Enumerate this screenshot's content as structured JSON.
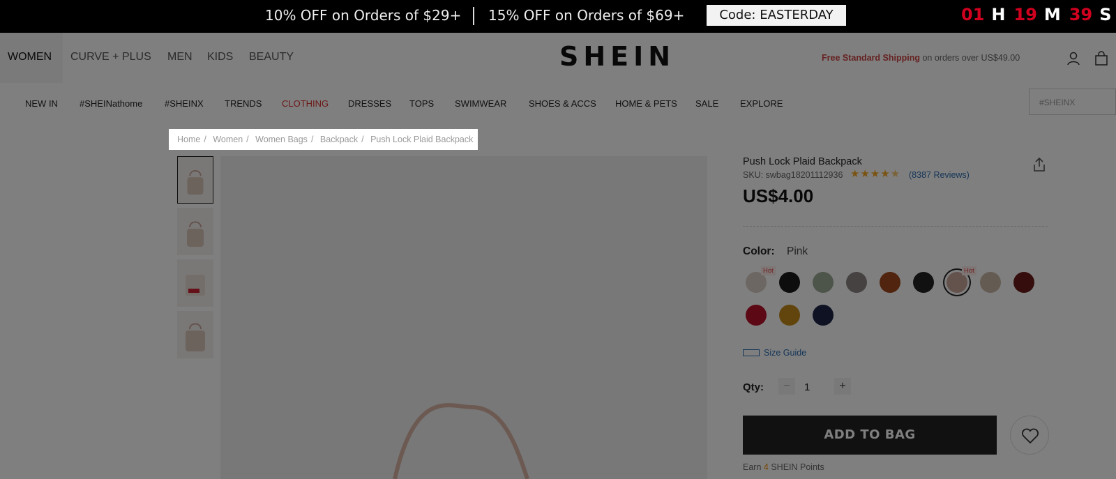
{
  "promo": {
    "offer1": "10% OFF on Orders of $29+",
    "offer2": "15% OFF on Orders of $69+",
    "code": "Code: EASTERDAY",
    "timer": {
      "hours": "01",
      "h_unit": "H",
      "minutes": "19",
      "m_unit": "M",
      "seconds": "39",
      "s_unit": "S"
    }
  },
  "header": {
    "categories": [
      "WOMEN",
      "CURVE + PLUS",
      "MEN",
      "KIDS",
      "BEAUTY"
    ],
    "logo": "SHEIN",
    "shipping_highlight": "Free Standard Shipping",
    "shipping_rest": "on orders over US$49.00"
  },
  "nav": {
    "items": [
      "NEW IN",
      "#SHEINathome",
      "#SHEINX",
      "TRENDS",
      "CLOTHING",
      "DRESSES",
      "TOPS",
      "SWIMWEAR",
      "SHOES & ACCS",
      "HOME & PETS",
      "SALE",
      "EXPLORE"
    ],
    "search_placeholder": "#SHEINX"
  },
  "breadcrumb": [
    "Home",
    "Women",
    "Women Bags",
    "Backpack",
    "Push Lock Plaid Backpack"
  ],
  "product": {
    "title": "Push Lock Plaid Backpack",
    "sku": "SKU: swbag18201112936",
    "rating": 4.5,
    "reviews": "(8387 Reviews)",
    "price": "US$4.00",
    "color_label": "Color:",
    "color_value": "Pink",
    "hot_label": "Hot",
    "swatches": [
      {
        "color": "#d9cfc6",
        "hot": true
      },
      {
        "color": "#1a1a1a",
        "hot": false
      },
      {
        "color": "#9aaa95",
        "hot": false
      },
      {
        "color": "#8e8585",
        "hot": false
      },
      {
        "color": "#a0481c",
        "hot": false
      },
      {
        "color": "#222222",
        "hot": false
      },
      {
        "color": "#c9a59a",
        "hot": true,
        "selected": true
      },
      {
        "color": "#c8b7a5",
        "hot": false
      },
      {
        "color": "#6a1a1a",
        "hot": false
      },
      {
        "color": "#b8122a",
        "hot": false
      },
      {
        "color": "#c48a1a",
        "hot": false
      },
      {
        "color": "#1c2446",
        "hot": false
      }
    ],
    "size_guide": "Size Guide",
    "qty_label": "Qty:",
    "qty_value": "1",
    "minus": "−",
    "plus": "+",
    "add_to_bag": "ADD TO BAG",
    "points_prefix": "Earn",
    "points_value": "4",
    "points_suffix": "SHEIN Points"
  }
}
